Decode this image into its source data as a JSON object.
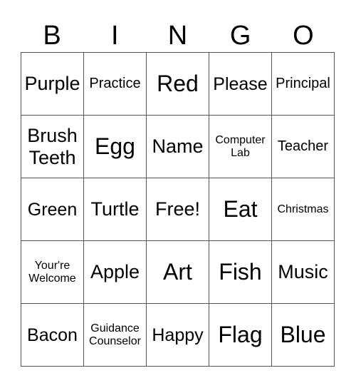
{
  "header": [
    "B",
    "I",
    "N",
    "G",
    "O"
  ],
  "cells": [
    {
      "text": "Purple",
      "size": "s-l"
    },
    {
      "text": "Practice",
      "size": "s-s"
    },
    {
      "text": "Red",
      "size": "s-xl"
    },
    {
      "text": "Please",
      "size": "s-m"
    },
    {
      "text": "Principal",
      "size": "s-s"
    },
    {
      "text": "Brush Teeth",
      "size": "s-l"
    },
    {
      "text": "Egg",
      "size": "s-xl"
    },
    {
      "text": "Name",
      "size": "s-l"
    },
    {
      "text": "Computer Lab",
      "size": "s-xs"
    },
    {
      "text": "Teacher",
      "size": "s-s"
    },
    {
      "text": "Green",
      "size": "s-m"
    },
    {
      "text": "Turtle",
      "size": "s-l"
    },
    {
      "text": "Free!",
      "size": "s-l"
    },
    {
      "text": "Eat",
      "size": "s-xl"
    },
    {
      "text": "Christmas",
      "size": "s-xs"
    },
    {
      "text": "Your're Welcome",
      "size": "s-xs"
    },
    {
      "text": "Apple",
      "size": "s-l"
    },
    {
      "text": "Art",
      "size": "s-xl"
    },
    {
      "text": "Fish",
      "size": "s-xl"
    },
    {
      "text": "Music",
      "size": "s-l"
    },
    {
      "text": "Bacon",
      "size": "s-m"
    },
    {
      "text": "Guidance Counselor",
      "size": "s-xs"
    },
    {
      "text": "Happy",
      "size": "s-m"
    },
    {
      "text": "Flag",
      "size": "s-xl"
    },
    {
      "text": "Blue",
      "size": "s-xl"
    }
  ]
}
